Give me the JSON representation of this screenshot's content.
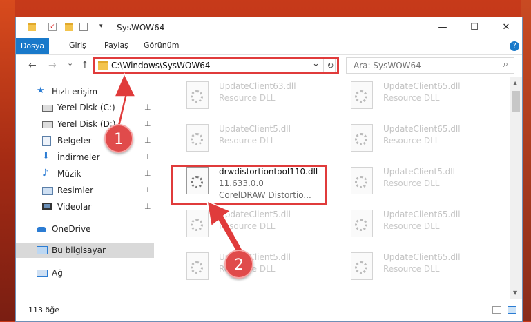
{
  "window": {
    "title": "SysWOW64",
    "minimize": "—",
    "maximize": "☐",
    "close": "✕"
  },
  "ribbon": {
    "tabs": [
      "Dosya",
      "Giriş",
      "Paylaş",
      "Görünüm"
    ],
    "help": "?"
  },
  "address": {
    "back": "←",
    "forward": "→",
    "recent": "⌄",
    "up": "↑",
    "path": "C:\\Windows\\SysWOW64",
    "dropdown": "⌄",
    "refresh": "↻",
    "search_placeholder": "Ara: SysWOW64",
    "search_icon": "⌕"
  },
  "sidebar": {
    "items": [
      {
        "label": "Hızlı erişim",
        "icon": "star-icon",
        "pinned": false
      },
      {
        "label": "Yerel Disk (C:)",
        "icon": "drive-icon",
        "pinned": true
      },
      {
        "label": "Yerel Disk (D:)",
        "icon": "drive-icon",
        "pinned": true
      },
      {
        "label": "Belgeler",
        "icon": "documents-icon",
        "pinned": true
      },
      {
        "label": "İndirmeler",
        "icon": "downloads-icon",
        "pinned": true
      },
      {
        "label": "Müzik",
        "icon": "music-icon",
        "pinned": true
      },
      {
        "label": "Resimler",
        "icon": "pictures-icon",
        "pinned": true
      },
      {
        "label": "Videolar",
        "icon": "videos-icon",
        "pinned": true
      },
      {
        "label": "OneDrive",
        "icon": "cloud-icon",
        "pinned": false
      },
      {
        "label": "Bu bilgisayar",
        "icon": "computer-icon",
        "pinned": false
      },
      {
        "label": "Ağ",
        "icon": "network-icon",
        "pinned": false
      }
    ],
    "pin_glyph": "📌"
  },
  "files": [
    {
      "name": "UpdateClient63.dll",
      "type": "Resource DLL",
      "extra": ""
    },
    {
      "name": "UpdateClient65.dll",
      "type": "Resource DLL",
      "extra": ""
    },
    {
      "name": "UpdateClient5.dll",
      "type": "Resource DLL",
      "extra": ""
    },
    {
      "name": "UpdateClient65.dll",
      "type": "Resource DLL",
      "extra": ""
    },
    {
      "name": "drwdistortiontool110.dll",
      "type": "11.633.0.0",
      "extra": "CorelDRAW Distortio..."
    },
    {
      "name": "UpdateClient5.dll",
      "type": "Resource DLL",
      "extra": ""
    },
    {
      "name": "UpdateClient5.dll",
      "type": "Resource DLL",
      "extra": ""
    },
    {
      "name": "UpdateClient65.dll",
      "type": "Resource DLL",
      "extra": ""
    },
    {
      "name": "UpdateClient5.dll",
      "type": "Resource DLL",
      "extra": ""
    },
    {
      "name": "UpdateClient65.dll",
      "type": "Resource DLL",
      "extra": ""
    }
  ],
  "status": {
    "count": "113 öğe"
  },
  "annotations": {
    "step1": "1",
    "step2": "2",
    "color": "#e03b3b"
  }
}
